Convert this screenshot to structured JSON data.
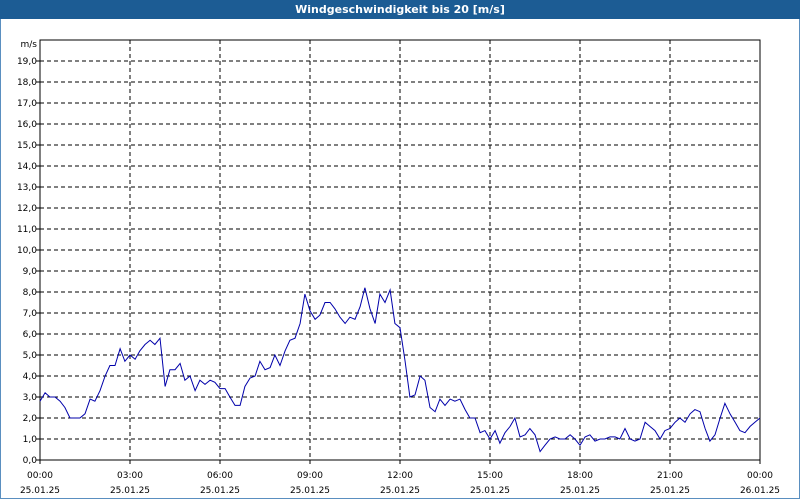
{
  "window": {
    "title": "Windgeschwindigkeit bis 20 [m/s]"
  },
  "colors": {
    "title_bar": "#1c5c94",
    "series": "#0000aa",
    "grid": "#000000",
    "background": "#ffffff"
  },
  "chart_data": {
    "type": "line",
    "title": "Windgeschwindigkeit bis 20 [m/s]",
    "ylabel": "m/s",
    "ylim": [
      0,
      20
    ],
    "y_ticks": [
      "0,0",
      "1,0",
      "2,0",
      "3,0",
      "4,0",
      "5,0",
      "6,0",
      "7,0",
      "8,0",
      "9,0",
      "10,0",
      "11,0",
      "12,0",
      "13,0",
      "14,0",
      "15,0",
      "16,0",
      "17,0",
      "18,0",
      "19,0"
    ],
    "x_ticks": [
      {
        "time": "00:00",
        "date": "25.01.25"
      },
      {
        "time": "03:00",
        "date": "25.01.25"
      },
      {
        "time": "06:00",
        "date": "25.01.25"
      },
      {
        "time": "09:00",
        "date": "25.01.25"
      },
      {
        "time": "12:00",
        "date": "25.01.25"
      },
      {
        "time": "15:00",
        "date": "25.01.25"
      },
      {
        "time": "18:00",
        "date": "25.01.25"
      },
      {
        "time": "21:00",
        "date": "25.01.25"
      },
      {
        "time": "00:00",
        "date": "26.01.25"
      }
    ],
    "xlim_hours": [
      0,
      24
    ],
    "grid": true,
    "series": [
      {
        "values": [
          [
            0.0,
            2.8
          ],
          [
            0.17,
            3.2
          ],
          [
            0.33,
            3.0
          ],
          [
            0.5,
            3.0
          ],
          [
            0.67,
            2.8
          ],
          [
            0.83,
            2.5
          ],
          [
            1.0,
            2.0
          ],
          [
            1.17,
            2.0
          ],
          [
            1.33,
            2.0
          ],
          [
            1.5,
            2.2
          ],
          [
            1.67,
            2.9
          ],
          [
            1.83,
            2.8
          ],
          [
            2.0,
            3.3
          ],
          [
            2.17,
            4.0
          ],
          [
            2.33,
            4.5
          ],
          [
            2.5,
            4.5
          ],
          [
            2.67,
            5.3
          ],
          [
            2.83,
            4.7
          ],
          [
            3.0,
            5.0
          ],
          [
            3.17,
            4.8
          ],
          [
            3.33,
            5.2
          ],
          [
            3.5,
            5.5
          ],
          [
            3.67,
            5.7
          ],
          [
            3.83,
            5.5
          ],
          [
            4.0,
            5.8
          ],
          [
            4.17,
            3.5
          ],
          [
            4.33,
            4.3
          ],
          [
            4.5,
            4.3
          ],
          [
            4.67,
            4.6
          ],
          [
            4.83,
            3.8
          ],
          [
            5.0,
            4.0
          ],
          [
            5.17,
            3.3
          ],
          [
            5.33,
            3.8
          ],
          [
            5.5,
            3.6
          ],
          [
            5.67,
            3.8
          ],
          [
            5.83,
            3.7
          ],
          [
            6.0,
            3.4
          ],
          [
            6.17,
            3.4
          ],
          [
            6.33,
            3.0
          ],
          [
            6.5,
            2.6
          ],
          [
            6.67,
            2.6
          ],
          [
            6.83,
            3.5
          ],
          [
            7.0,
            3.9
          ],
          [
            7.17,
            4.0
          ],
          [
            7.33,
            4.7
          ],
          [
            7.5,
            4.3
          ],
          [
            7.67,
            4.4
          ],
          [
            7.83,
            5.0
          ],
          [
            8.0,
            4.5
          ],
          [
            8.17,
            5.2
          ],
          [
            8.33,
            5.7
          ],
          [
            8.5,
            5.8
          ],
          [
            8.67,
            6.5
          ],
          [
            8.83,
            7.9
          ],
          [
            9.0,
            7.1
          ],
          [
            9.17,
            6.7
          ],
          [
            9.33,
            6.9
          ],
          [
            9.5,
            7.5
          ],
          [
            9.67,
            7.5
          ],
          [
            9.83,
            7.2
          ],
          [
            10.0,
            6.8
          ],
          [
            10.17,
            6.5
          ],
          [
            10.33,
            6.8
          ],
          [
            10.5,
            6.7
          ],
          [
            10.67,
            7.3
          ],
          [
            10.83,
            8.2
          ],
          [
            11.0,
            7.2
          ],
          [
            11.17,
            6.5
          ],
          [
            11.33,
            7.9
          ],
          [
            11.5,
            7.5
          ],
          [
            11.67,
            8.1
          ],
          [
            11.83,
            6.5
          ],
          [
            12.0,
            6.3
          ],
          [
            12.17,
            4.7
          ],
          [
            12.33,
            3.0
          ],
          [
            12.5,
            3.1
          ],
          [
            12.67,
            4.0
          ],
          [
            12.83,
            3.8
          ],
          [
            13.0,
            2.5
          ],
          [
            13.17,
            2.3
          ],
          [
            13.33,
            2.9
          ],
          [
            13.5,
            2.6
          ],
          [
            13.67,
            2.9
          ],
          [
            13.83,
            2.8
          ],
          [
            14.0,
            2.9
          ],
          [
            14.17,
            2.4
          ],
          [
            14.33,
            2.0
          ],
          [
            14.5,
            2.0
          ],
          [
            14.67,
            1.3
          ],
          [
            14.83,
            1.4
          ],
          [
            15.0,
            1.0
          ],
          [
            15.17,
            1.4
          ],
          [
            15.33,
            0.8
          ],
          [
            15.5,
            1.3
          ],
          [
            15.67,
            1.6
          ],
          [
            15.83,
            2.0
          ],
          [
            16.0,
            1.1
          ],
          [
            16.17,
            1.2
          ],
          [
            16.33,
            1.5
          ],
          [
            16.5,
            1.2
          ],
          [
            16.67,
            0.4
          ],
          [
            16.83,
            0.7
          ],
          [
            17.0,
            1.0
          ],
          [
            17.17,
            1.1
          ],
          [
            17.33,
            1.0
          ],
          [
            17.5,
            1.0
          ],
          [
            17.67,
            1.2
          ],
          [
            17.83,
            1.0
          ],
          [
            18.0,
            0.7
          ],
          [
            18.17,
            1.1
          ],
          [
            18.33,
            1.2
          ],
          [
            18.5,
            0.9
          ],
          [
            18.67,
            1.0
          ],
          [
            18.83,
            1.0
          ],
          [
            19.0,
            1.1
          ],
          [
            19.17,
            1.1
          ],
          [
            19.33,
            1.0
          ],
          [
            19.5,
            1.5
          ],
          [
            19.67,
            1.0
          ],
          [
            19.83,
            0.9
          ],
          [
            20.0,
            1.0
          ],
          [
            20.17,
            1.8
          ],
          [
            20.33,
            1.6
          ],
          [
            20.5,
            1.4
          ],
          [
            20.67,
            1.0
          ],
          [
            20.83,
            1.4
          ],
          [
            21.0,
            1.5
          ],
          [
            21.17,
            1.8
          ],
          [
            21.33,
            2.0
          ],
          [
            21.5,
            1.8
          ],
          [
            21.67,
            2.2
          ],
          [
            21.83,
            2.4
          ],
          [
            22.0,
            2.3
          ],
          [
            22.17,
            1.5
          ],
          [
            22.33,
            0.9
          ],
          [
            22.5,
            1.2
          ],
          [
            22.67,
            2.0
          ],
          [
            22.83,
            2.7
          ],
          [
            23.0,
            2.2
          ],
          [
            23.17,
            1.8
          ],
          [
            23.33,
            1.4
          ],
          [
            23.5,
            1.3
          ],
          [
            23.67,
            1.6
          ],
          [
            23.83,
            1.8
          ],
          [
            24.0,
            2.0
          ]
        ]
      }
    ]
  }
}
